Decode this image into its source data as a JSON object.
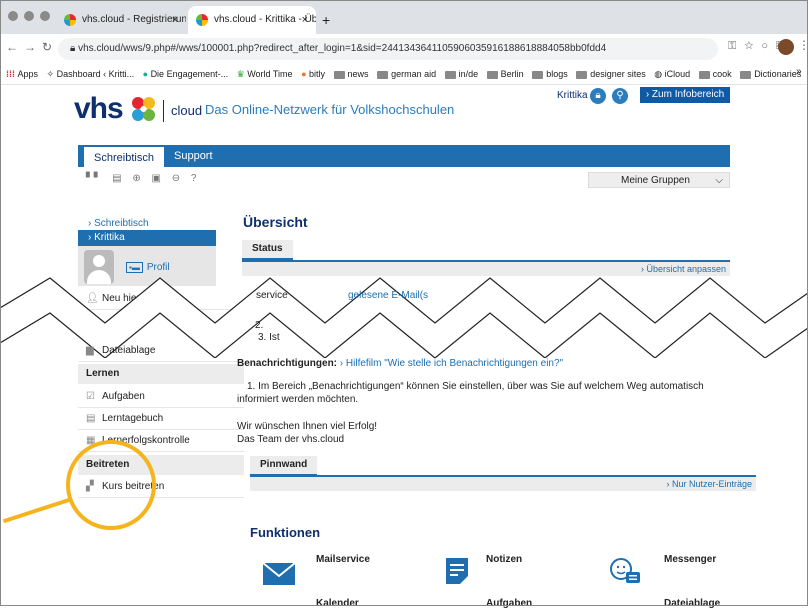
{
  "browser": {
    "tabs": [
      {
        "title": "vhs.cloud - Registrierung als N"
      },
      {
        "title": "vhs.cloud - Krittika - Übersicht"
      }
    ],
    "close_glyph": "×",
    "new_tab_glyph": "+",
    "url": "vhs.cloud/wws/9.php#/wws/100001.php?redirect_after_login=1&sid=2441343641105906035916188618884058bb0fdd4",
    "bookmarks": [
      "Apps",
      "Dashboard ‹ Kritti...",
      "Die Engagement-...",
      "World Time",
      "bitly",
      "news",
      "german aid",
      "in/de",
      "Berlin",
      "blogs",
      "designer sites",
      "iCloud",
      "cook",
      "Dictionaries"
    ],
    "bookmarks_overflow": "»"
  },
  "header": {
    "logo_text": "vhs",
    "cloud_label": "cloud",
    "tagline": "Das Online-Netzwerk für Volkshochschulen",
    "user_name": "Krittika",
    "info_button": "› Zum Infobereich"
  },
  "nav": {
    "tabs": [
      "Schreibtisch",
      "Support"
    ],
    "groups_select": "Meine Gruppen",
    "groups_chevron": "⌵",
    "tool_icons": "▝▘ ▤ ⊕ ▣ ⊖ ?"
  },
  "sidebar": {
    "links": [
      "› Schreibtisch",
      "› Krittika"
    ],
    "profile": "Profil",
    "new_here": "Neu hier?",
    "file_storage": "Dateiablage",
    "sections": {
      "lernen": "Lernen",
      "beitreten": "Beitreten"
    },
    "lernen_items": [
      "Aufgaben",
      "Lerntagebuch",
      "Lernerfolgskontrolle"
    ],
    "beitreten_items": [
      "Kurs beitreten"
    ]
  },
  "main": {
    "title": "Übersicht",
    "status_tab": "Status",
    "customize_link": "› Übersicht anpassen",
    "fragment_service": "service",
    "fragment_unread": "gelesene E-Mail(s",
    "list_fragment_2": "2.",
    "list_fragment_3": "3. Ist",
    "notifications_label": "Benachrichtigungen:",
    "notifications_link": "› Hilfefilm \"Wie stelle ich Benachrichtigungen ein?\"",
    "notifications_text": "1. Im Bereich „Benachrichtigungen“ können Sie einstellen, über was Sie auf welchem Weg automatisch informiert werden möchten.",
    "closing_1": "Wir wünschen Ihnen viel Erfolg!",
    "closing_2": "Das Team der vhs.cloud",
    "pinboard_tab": "Pinnwand",
    "pinboard_link": "› Nur Nutzer-Einträge",
    "functions_title": "Funktionen",
    "functions": [
      "Mailservice",
      "Notizen",
      "Messenger",
      "Kalender",
      "Aufgaben",
      "Dateiablage"
    ]
  },
  "colors": {
    "brand_blue": "#1e6eb0",
    "dark_blue": "#0f2f6e",
    "highlight": "#f5b41e"
  }
}
